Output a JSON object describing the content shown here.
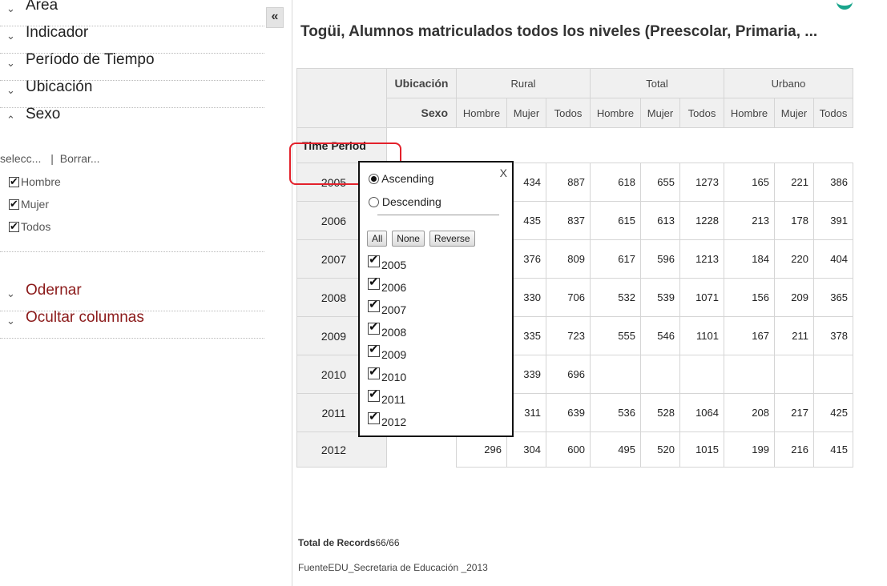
{
  "sidebar": {
    "items": [
      {
        "label": "Área",
        "chevron": "chevron-down"
      },
      {
        "label": "Indicador",
        "chevron": "chevron-down"
      },
      {
        "label": "Período de Tiempo",
        "chevron": "chevron-down"
      },
      {
        "label": "Ubicación",
        "chevron": "chevron-down"
      },
      {
        "label": "Sexo",
        "chevron": "chevron-up"
      }
    ],
    "select_all": "selecc...",
    "separator": "|",
    "clear": "Borrar...",
    "sexo_options": [
      {
        "label": "Hombre",
        "checked": true
      },
      {
        "label": "Mujer",
        "checked": true
      },
      {
        "label": "Todos",
        "checked": true
      }
    ],
    "extra_items": [
      {
        "label": "Odernar",
        "chevron": "chevron-down"
      },
      {
        "label": "Ocultar columnas",
        "chevron": "chevron-down"
      }
    ]
  },
  "collapse_label": "«",
  "title": "Togüi, Alumnos matriculados todos los niveles (Preescolar, Primaria, ...",
  "table": {
    "ubicacion_label": "Ubicación",
    "sexo_label": "Sexo",
    "time_period_label": "Time Period",
    "groups": [
      "Rural",
      "Total",
      "Urbano"
    ],
    "sub_headers": [
      "Hombre",
      "Mujer",
      "Todos",
      "Hombre",
      "Mujer",
      "Todos",
      "Hombre",
      "Mujer",
      "Todos"
    ],
    "rows": [
      {
        "year": "2005",
        "values": [
          "",
          "434",
          "887",
          "618",
          "655",
          "1273",
          "165",
          "221",
          "386"
        ]
      },
      {
        "year": "2006",
        "values": [
          "",
          "435",
          "837",
          "615",
          "613",
          "1228",
          "213",
          "178",
          "391"
        ]
      },
      {
        "year": "2007",
        "values": [
          "",
          "376",
          "809",
          "617",
          "596",
          "1213",
          "184",
          "220",
          "404"
        ]
      },
      {
        "year": "2008",
        "values": [
          "",
          "330",
          "706",
          "532",
          "539",
          "1071",
          "156",
          "209",
          "365"
        ]
      },
      {
        "year": "2009",
        "values": [
          "",
          "335",
          "723",
          "555",
          "546",
          "1101",
          "167",
          "211",
          "378"
        ]
      },
      {
        "year": "2010",
        "values": [
          "",
          "339",
          "696",
          "",
          "",
          "",
          "",
          "",
          ""
        ]
      },
      {
        "year": "2011",
        "values": [
          "",
          "311",
          "639",
          "536",
          "528",
          "1064",
          "208",
          "217",
          "425"
        ]
      },
      {
        "year": "2012",
        "values": [
          "296",
          "304",
          "600",
          "495",
          "520",
          "1015",
          "199",
          "216",
          "415"
        ]
      }
    ]
  },
  "sort_popup": {
    "close": "X",
    "ascending": "Ascending",
    "descending": "Descending",
    "selected": "Ascending",
    "buttons": [
      "All",
      "None",
      "Reverse"
    ],
    "years": [
      {
        "label": "2005",
        "checked": true
      },
      {
        "label": "2006",
        "checked": true
      },
      {
        "label": "2007",
        "checked": true
      },
      {
        "label": "2008",
        "checked": true
      },
      {
        "label": "2009",
        "checked": true
      },
      {
        "label": "2010",
        "checked": true
      },
      {
        "label": "2011",
        "checked": true
      },
      {
        "label": "2012",
        "checked": true
      }
    ]
  },
  "footer": {
    "records_label": "Total de Records",
    "records_value": "66/66",
    "source": "FuenteEDU_Secretaria de Educación _2013"
  },
  "colors": {
    "highlight_box": "#e3212b",
    "sidebar_red_text": "#8b1a1a",
    "accent_teal": "#1aa58c"
  }
}
